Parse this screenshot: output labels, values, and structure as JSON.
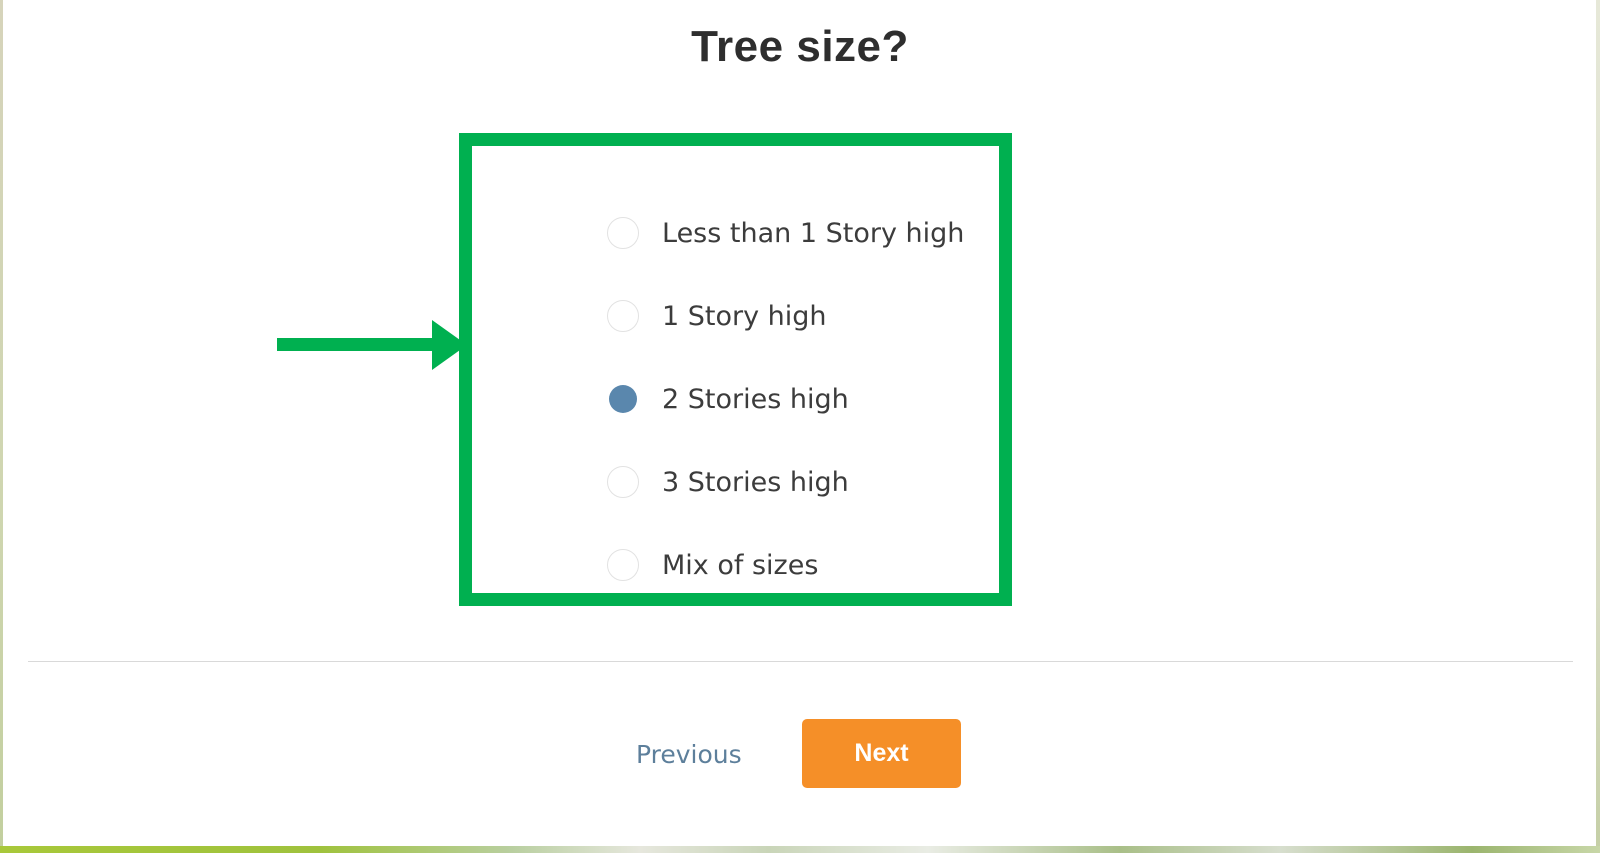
{
  "question": {
    "title": "Tree size?"
  },
  "options": [
    {
      "label": "Less than 1 Story high",
      "selected": false
    },
    {
      "label": "1 Story high",
      "selected": false
    },
    {
      "label": "2 Stories high",
      "selected": true
    },
    {
      "label": "3 Stories high",
      "selected": false
    },
    {
      "label": "Mix of sizes",
      "selected": false
    }
  ],
  "navigation": {
    "previous_label": "Previous",
    "next_label": "Next"
  },
  "annotation": {
    "highlight_color": "#00b050",
    "arrow_color": "#00b050"
  },
  "colors": {
    "selected_radio": "#5a87ad",
    "next_button": "#f58f28",
    "previous_link": "#5d7f9b"
  }
}
